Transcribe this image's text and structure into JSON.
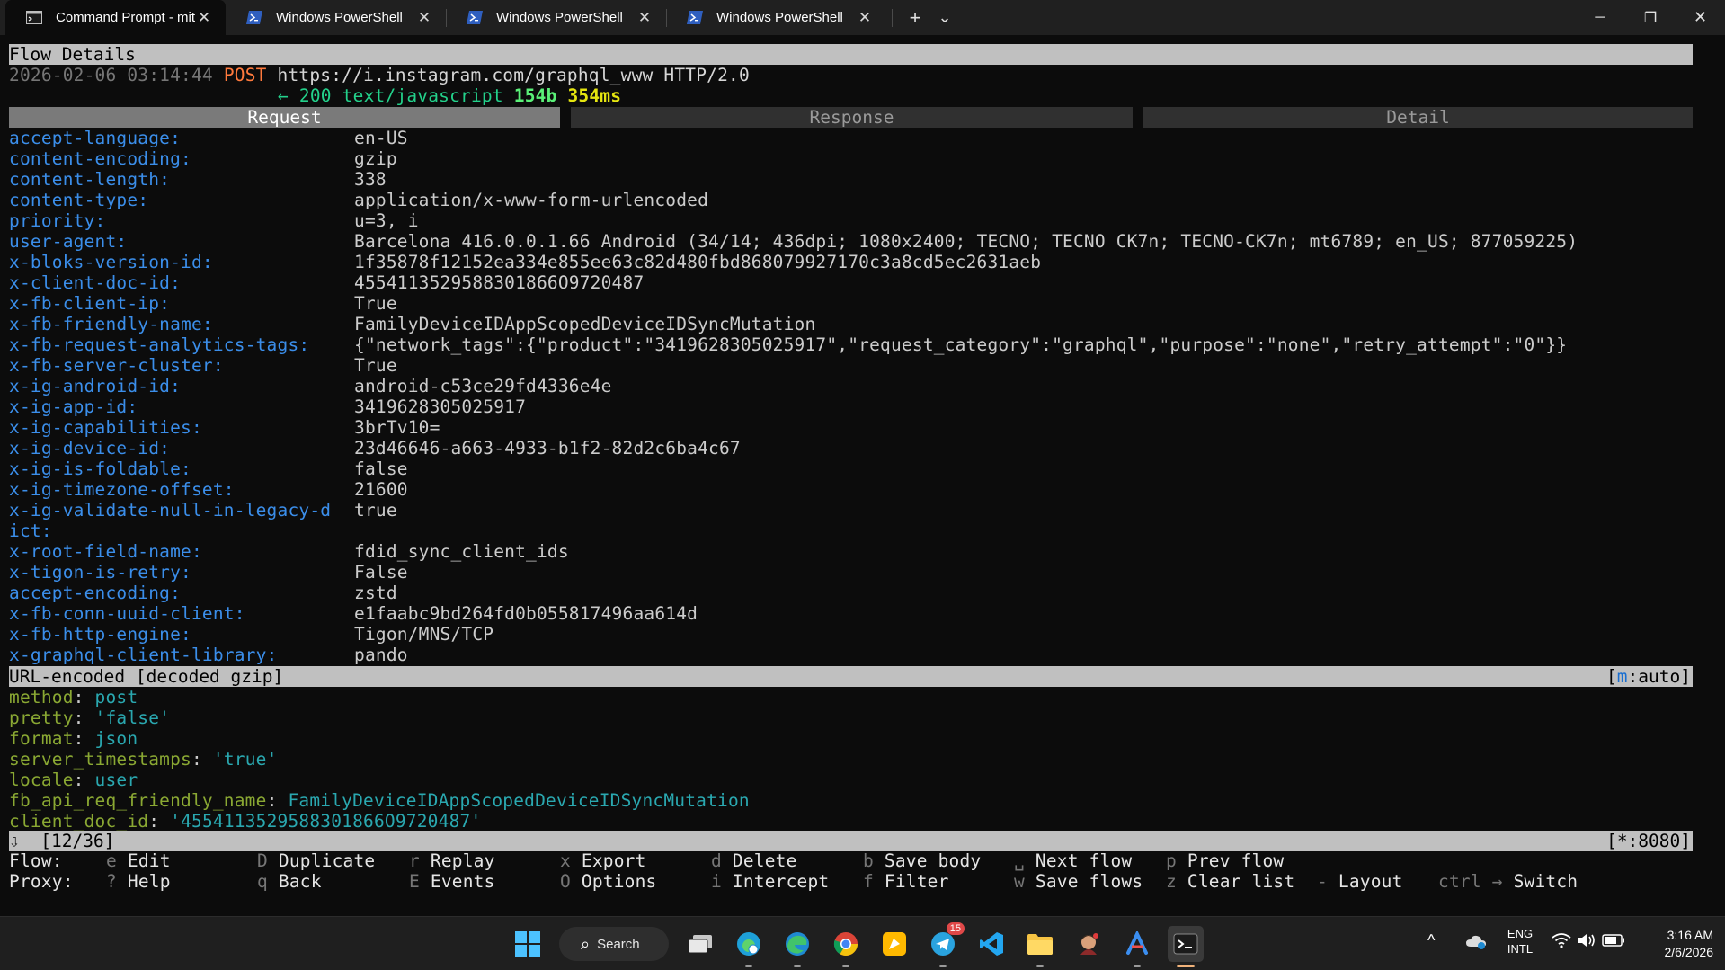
{
  "tabs": [
    {
      "label": "Command Prompt - mitmpro:",
      "icon": "command-prompt-icon",
      "active": true
    },
    {
      "label": "Windows PowerShell",
      "icon": "powershell-icon"
    },
    {
      "label": "Windows PowerShell",
      "icon": "powershell-icon"
    },
    {
      "label": "Windows PowerShell",
      "icon": "powershell-icon"
    }
  ],
  "tab_controls": {
    "new_tab": "+",
    "dropdown": "⌄"
  },
  "window_controls": {
    "minimize": "─",
    "restore": "❐",
    "close": "✕"
  },
  "flow": {
    "header": "Flow Details",
    "timestamp": "2026-02-06 03:14:44",
    "method": "POST",
    "url": "https://i.instagram.com/graphql_www HTTP/2.0",
    "arrow": "←",
    "status": "200",
    "content_type": "text/javascript",
    "size": "154b",
    "duration": "354ms"
  },
  "view_tabs": {
    "request": "Request",
    "response": "Response",
    "detail": "Detail"
  },
  "headers": [
    {
      "k": "accept-language:",
      "v": "en-US"
    },
    {
      "k": "content-encoding:",
      "v": "gzip"
    },
    {
      "k": "content-length:",
      "v": "338"
    },
    {
      "k": "content-type:",
      "v": "application/x-www-form-urlencoded"
    },
    {
      "k": "priority:",
      "v": "u=3, i"
    },
    {
      "k": "user-agent:",
      "v": "Barcelona 416.0.0.1.66 Android (34/14; 436dpi; 1080x2400; TECNO; TECNO CK7n; TECNO-CK7n; mt6789; en_US; 877059225)"
    },
    {
      "k": "x-bloks-version-id:",
      "v": "1f35878f12152ea334e855ee63c82d480fbd868079927170c3a8cd5ec2631aeb"
    },
    {
      "k": "x-client-doc-id:",
      "v": "4554113529588301866O9720487"
    },
    {
      "k": "x-fb-client-ip:",
      "v": "True"
    },
    {
      "k": "x-fb-friendly-name:",
      "v": "FamilyDeviceIDAppScopedDeviceIDSyncMutation"
    },
    {
      "k": "x-fb-request-analytics-tags:",
      "v": "{\"network_tags\":{\"product\":\"3419628305025917\",\"request_category\":\"graphql\",\"purpose\":\"none\",\"retry_attempt\":\"0\"}}"
    },
    {
      "k": "x-fb-server-cluster:",
      "v": "True"
    },
    {
      "k": "x-ig-android-id:",
      "v": "android-c53ce29fd4336e4e"
    },
    {
      "k": "x-ig-app-id:",
      "v": "3419628305025917"
    },
    {
      "k": "x-ig-capabilities:",
      "v": "3brTv10="
    },
    {
      "k": "x-ig-device-id:",
      "v": "23d46646-a663-4933-b1f2-82d2c6ba4c67"
    },
    {
      "k": "x-ig-is-foldable:",
      "v": "false"
    },
    {
      "k": "x-ig-timezone-offset:",
      "v": "21600"
    },
    {
      "k": "x-ig-validate-null-in-legacy-d",
      "v": "true"
    },
    {
      "k": "ict:",
      "v": ""
    },
    {
      "k": "x-root-field-name:",
      "v": "fdid_sync_client_ids"
    },
    {
      "k": "x-tigon-is-retry:",
      "v": "False"
    },
    {
      "k": "accept-encoding:",
      "v": "zstd"
    },
    {
      "k": "x-fb-conn-uuid-client:",
      "v": "e1faabc9bd264fd0b055817496aa614d"
    },
    {
      "k": "x-fb-http-engine:",
      "v": "Tigon/MNS/TCP"
    },
    {
      "k": "x-graphql-client-library:",
      "v": "pando"
    }
  ],
  "body_bar": {
    "left": "URL-encoded [decoded gzip]",
    "right_open": "[",
    "right_key": "m",
    "right_rest": ":auto]"
  },
  "form_fields": [
    {
      "k": "method",
      "v": "post"
    },
    {
      "k": "pretty",
      "v": "'false'"
    },
    {
      "k": "format",
      "v": "json"
    },
    {
      "k": "server_timestamps",
      "v": "'true'"
    },
    {
      "k": "locale",
      "v": "user"
    },
    {
      "k": "fb_api_req_friendly_name",
      "v": "FamilyDeviceIDAppScopedDeviceIDSyncMutation"
    },
    {
      "k": "client_doc_id",
      "v": "'4554113529588301866O9720487'"
    }
  ],
  "status_bar": {
    "icon": "⇩",
    "position": "[12/36]",
    "listen": "[*:8080]"
  },
  "keybind_rows": [
    {
      "label": "Flow:",
      "items": [
        {
          "key": "e",
          "cmd": "Edit"
        },
        {
          "key": "D",
          "cmd": "Duplicate"
        },
        {
          "key": "r",
          "cmd": "Replay"
        },
        {
          "key": "x",
          "cmd": "Export"
        },
        {
          "key": "d",
          "cmd": "Delete"
        },
        {
          "key": "b",
          "cmd": "Save body"
        },
        {
          "key": "␣",
          "cmd": "Next flow"
        },
        {
          "key": "p",
          "cmd": "Prev flow"
        }
      ]
    },
    {
      "label": "Proxy:",
      "items": [
        {
          "key": "?",
          "cmd": "Help"
        },
        {
          "key": "q",
          "cmd": "Back"
        },
        {
          "key": "E",
          "cmd": "Events"
        },
        {
          "key": "O",
          "cmd": "Options"
        },
        {
          "key": "i",
          "cmd": "Intercept"
        },
        {
          "key": "f",
          "cmd": "Filter"
        },
        {
          "key": "w",
          "cmd": "Save flows"
        },
        {
          "key": "z",
          "cmd": "Clear list"
        },
        {
          "key": "-",
          "cmd": "Layout"
        },
        {
          "key": "ctrl →",
          "cmd": "Switch"
        }
      ]
    }
  ],
  "taskbar": {
    "search_label": "Search",
    "telegram_badge": "15",
    "language_line1": "ENG",
    "language_line2": "INTL",
    "time": "3:16 AM",
    "date": "2/6/2026"
  },
  "colors": {
    "terminal_bg": "#0c0c0c",
    "header_key": "#3b8eea",
    "form_key": "#8aa833",
    "form_value": "#2aa8b0",
    "method_post": "#ff7a3d",
    "status_ok": "#23d18b",
    "bar_bg": "#c0c0c0"
  }
}
